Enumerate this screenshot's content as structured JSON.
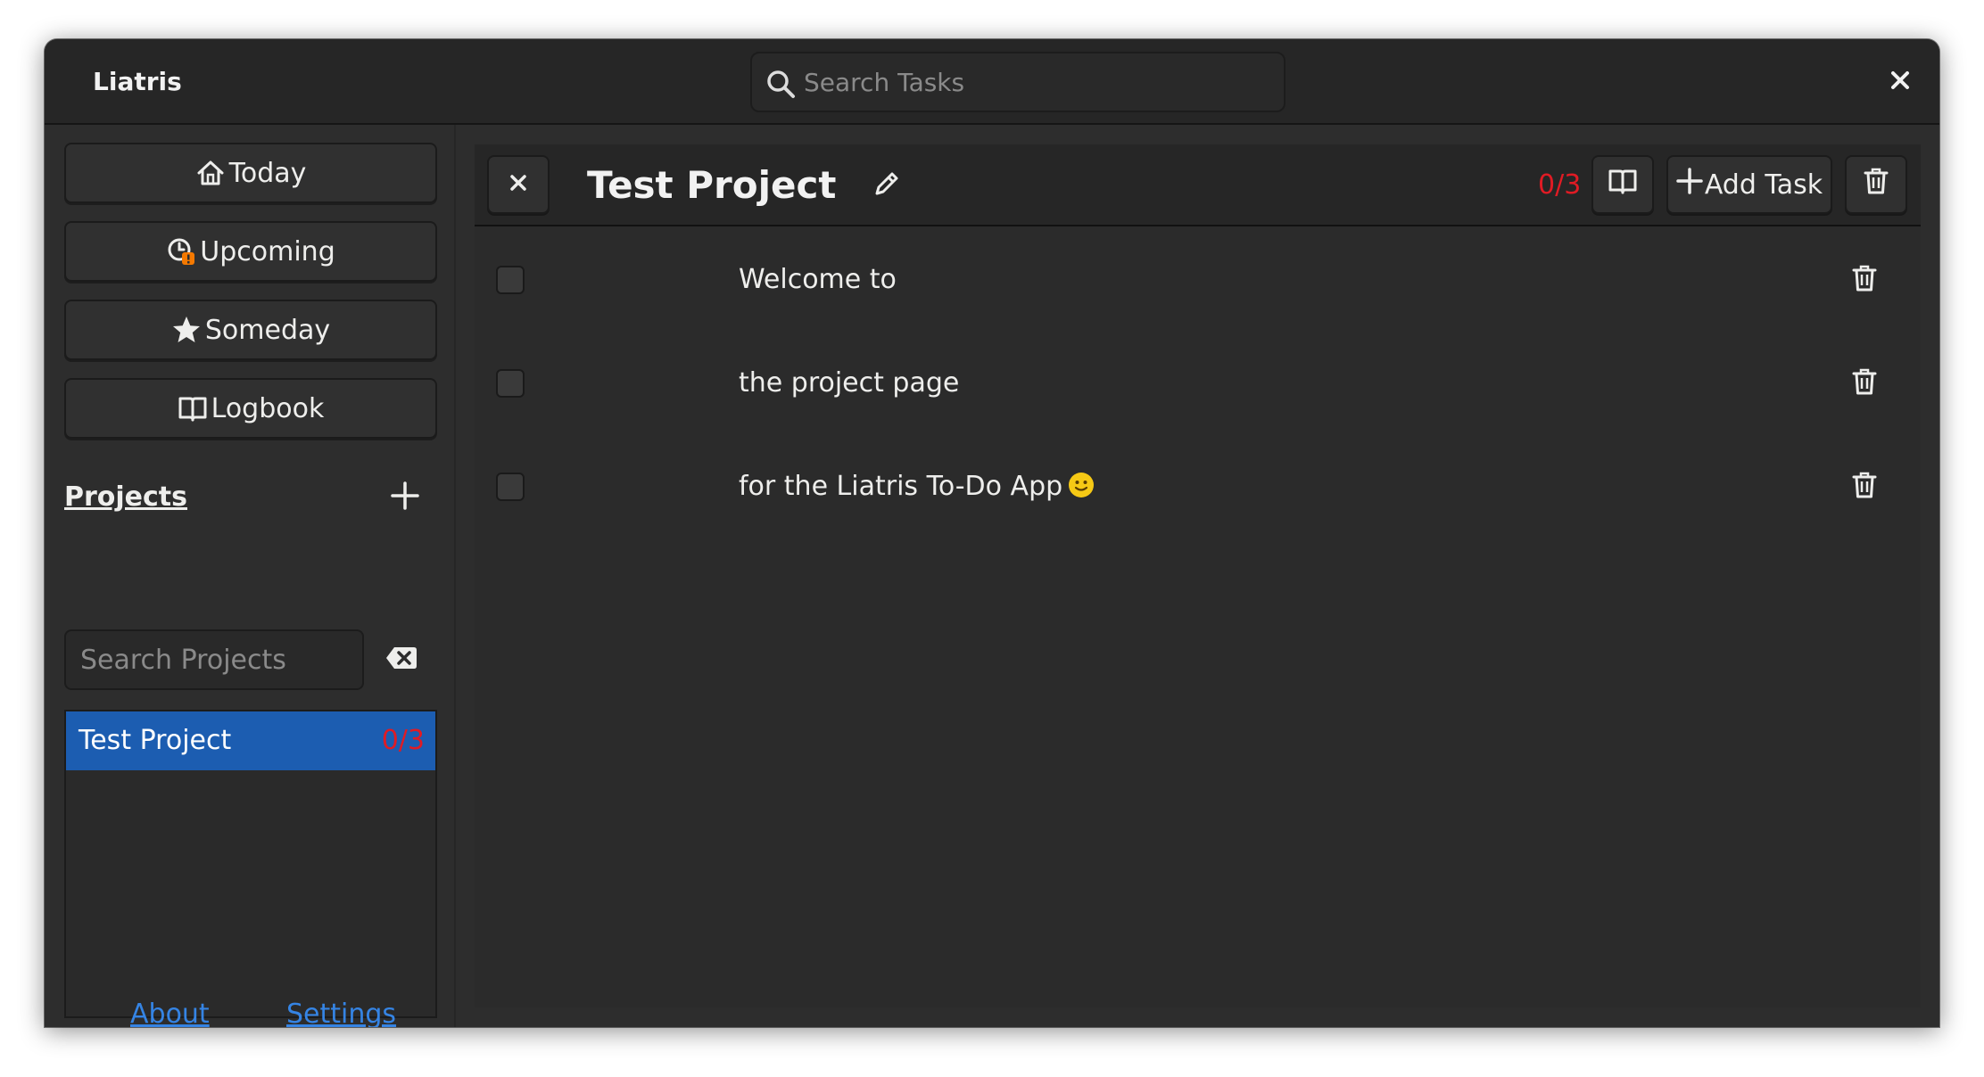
{
  "window": {
    "app_title": "Liatris",
    "task_search_placeholder": "Search Tasks"
  },
  "sidebar": {
    "nav": [
      {
        "label": "Today",
        "icon": "home-icon"
      },
      {
        "label": "Upcoming",
        "icon": "clock-warning-icon"
      },
      {
        "label": "Someday",
        "icon": "star-icon"
      },
      {
        "label": "Logbook",
        "icon": "book-icon"
      }
    ],
    "projects_heading": "Projects",
    "project_search_placeholder": "Search Projects",
    "projects": [
      {
        "name": "Test Project",
        "count": "0/3",
        "selected": true
      }
    ],
    "about_label": "About",
    "settings_label": "Settings"
  },
  "project": {
    "title": "Test Project",
    "count": "0/3",
    "add_task_label": "Add Task",
    "tasks": [
      {
        "text": "Welcome to",
        "done": false
      },
      {
        "text": "the project page",
        "done": false
      },
      {
        "text": "for the Liatris To-Do App",
        "emoji": "slightly-smiling-face",
        "done": false
      }
    ]
  },
  "colors": {
    "accent": "#1c5db1",
    "count": "#e01b24",
    "link": "#3584e4",
    "warning_badge": "#f57900",
    "background": "#2d2d2d"
  }
}
